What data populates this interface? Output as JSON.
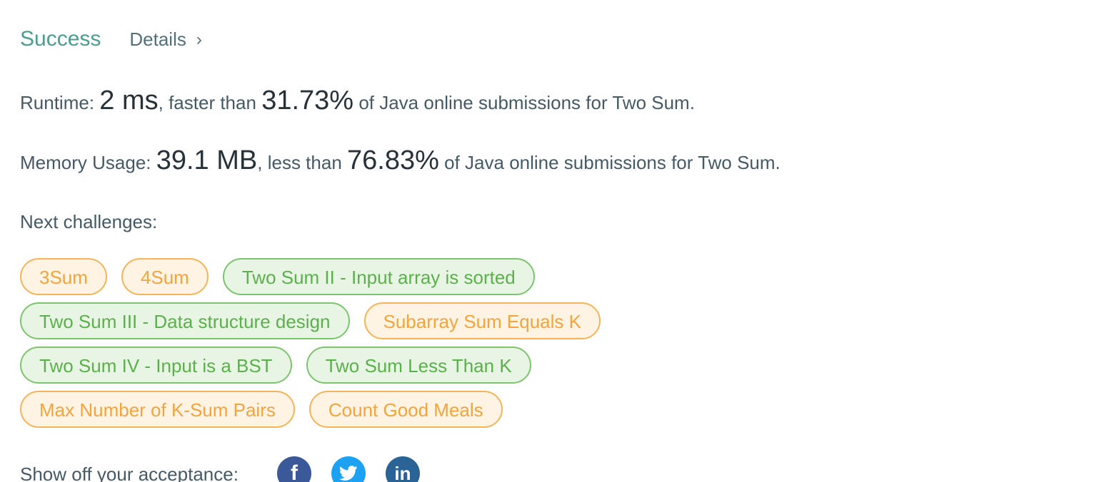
{
  "header": {
    "status": "Success",
    "details_label": "Details",
    "details_chevron": "›"
  },
  "runtime": {
    "label": "Runtime:",
    "value": "2 ms",
    "mid": ", faster than",
    "percent": "31.73%",
    "suffix": "of Java online submissions for Two Sum."
  },
  "memory": {
    "label": "Memory Usage:",
    "value": "39.1 MB",
    "mid": ", less than",
    "percent": "76.83%",
    "suffix": "of Java online submissions for Two Sum."
  },
  "next": {
    "label": "Next challenges:",
    "tags": [
      {
        "label": "3Sum",
        "difficulty": "medium"
      },
      {
        "label": "4Sum",
        "difficulty": "medium"
      },
      {
        "label": "Two Sum II - Input array is sorted",
        "difficulty": "easy"
      },
      {
        "label": "Two Sum III - Data structure design",
        "difficulty": "easy"
      },
      {
        "label": "Subarray Sum Equals K",
        "difficulty": "medium"
      },
      {
        "label": "Two Sum IV - Input is a BST",
        "difficulty": "easy"
      },
      {
        "label": "Two Sum Less Than K",
        "difficulty": "easy"
      },
      {
        "label": "Max Number of K-Sum Pairs",
        "difficulty": "medium"
      },
      {
        "label": "Count Good Meals",
        "difficulty": "medium"
      }
    ]
  },
  "share": {
    "label": "Show off your acceptance:",
    "icons": [
      "facebook-icon",
      "twitter-icon",
      "linkedin-icon"
    ]
  },
  "colors": {
    "success": "#4a9d8f",
    "medium_text": "#f3a43c",
    "easy_text": "#5cb04c",
    "facebook": "#3b5998",
    "twitter": "#1da1f2",
    "linkedin": "#2a6496"
  }
}
